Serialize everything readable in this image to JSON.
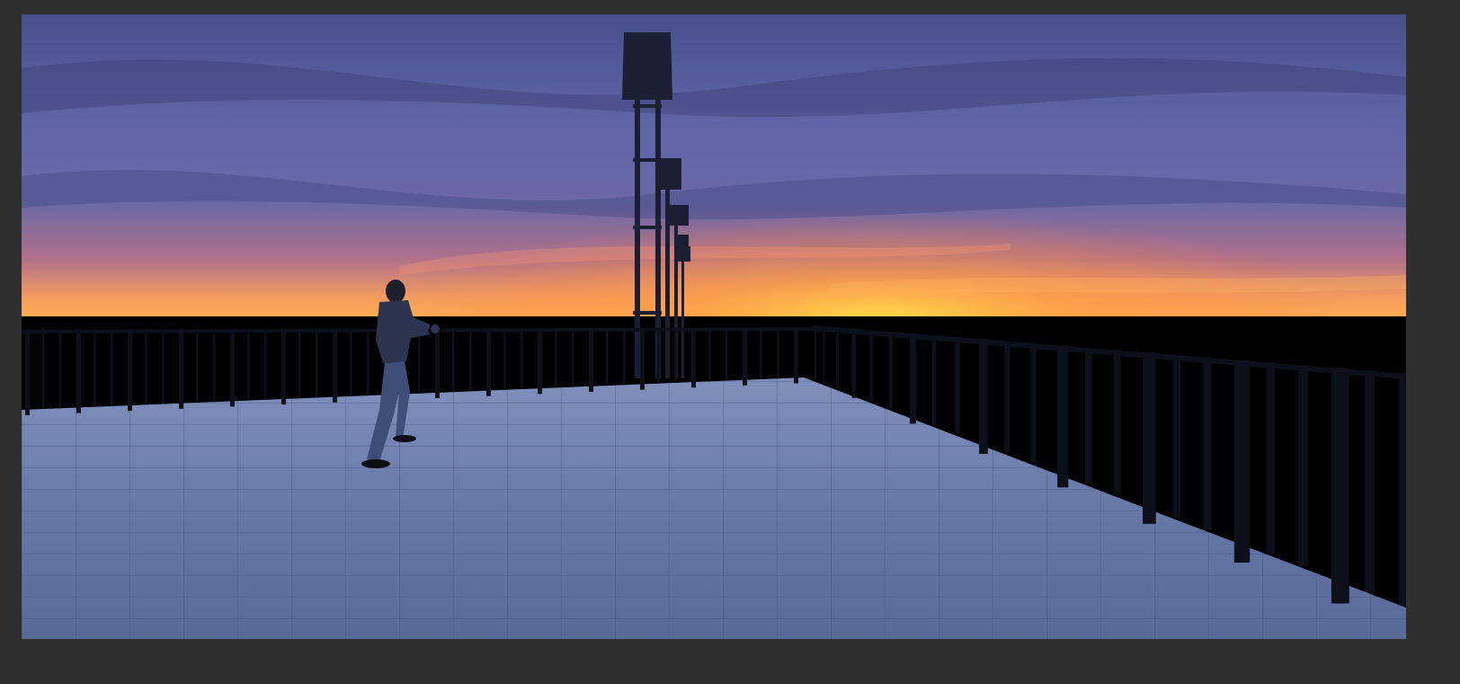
{
  "app": {
    "background_color": "#2f2f2f"
  },
  "scene": {
    "description_visible_text": "",
    "sky": {
      "top_color": "#4a5590",
      "mid_color": "#6a6fb0",
      "horizon_color": "#ff9a4a",
      "sun_glow_color": "#ffd24a"
    },
    "floor_color": "#6c7aa8",
    "railing_color": "#0b0d16",
    "wall_color": "#000000"
  }
}
